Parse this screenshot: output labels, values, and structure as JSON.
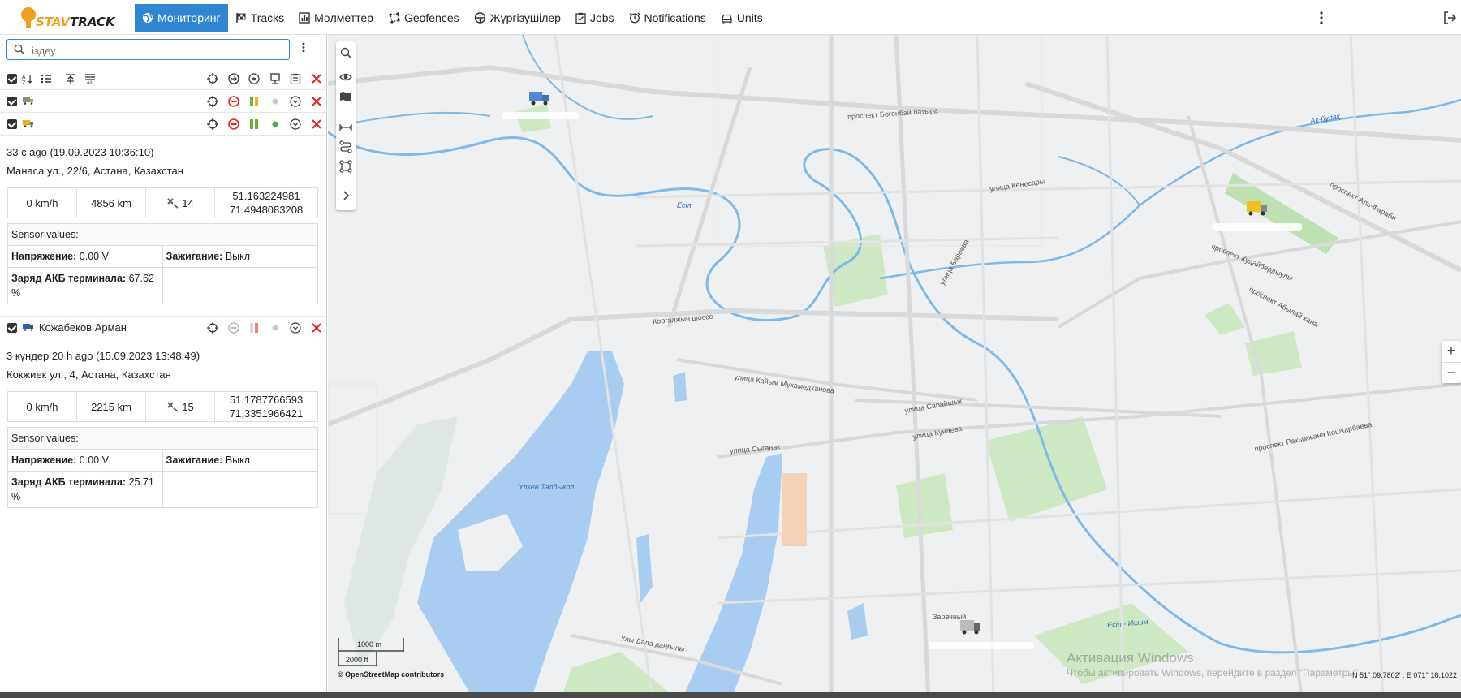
{
  "app": {
    "brand_a": "STAV",
    "brand_b": "TRACK"
  },
  "nav": [
    {
      "label": "Мониторинг",
      "icon": "globe-icon",
      "active": true
    },
    {
      "label": "Tracks",
      "icon": "flag-icon"
    },
    {
      "label": "Мәлметтер",
      "icon": "chart-icon"
    },
    {
      "label": "Geofences",
      "icon": "polygon-icon"
    },
    {
      "label": "Жүргізушілер",
      "icon": "driver-icon"
    },
    {
      "label": "Jobs",
      "icon": "clipboard-icon"
    },
    {
      "label": "Notifications",
      "icon": "alarm-icon"
    },
    {
      "label": "Units",
      "icon": "car-icon"
    }
  ],
  "search": {
    "placeholder": "іздеу"
  },
  "units": [
    {
      "name": ""
    },
    {
      "name": "",
      "last_seen": "33 с ago (19.09.2023 10:36:10)",
      "address": "Манаса ул., 22/6, Астана, Казахстан",
      "speed": "0 km/h",
      "mileage": "4856 km",
      "satellites": "14",
      "lat": "51.163224981",
      "lon": "71.4948083208",
      "sensor_title": "Sensor values:",
      "voltage_label": "Напряжение:",
      "voltage": "0.00 V",
      "ignition_label": "Зажигание:",
      "ignition": "Выкл",
      "battery_label": "Заряд АКБ терминала:",
      "battery": "67.62 %"
    },
    {
      "name": "Кожабеков Арман",
      "last_seen": "3 күндер 20 h ago (15.09.2023 13:48:49)",
      "address": "Кокжиек ул., 4, Астана, Казахстан",
      "speed": "0 km/h",
      "mileage": "2215 km",
      "satellites": "15",
      "lat": "51.1787766593",
      "lon": "71.3351966421",
      "sensor_title": "Sensor values:",
      "voltage_label": "Напряжение:",
      "voltage": "0.00 V",
      "ignition_label": "Зажигание:",
      "ignition": "Выкл",
      "battery_label": "Заряд АКБ терминала:",
      "battery": "25.71 %"
    }
  ],
  "map": {
    "scale_m": "1000 m",
    "scale_ft": "2000 ft",
    "attribution": "© OpenStreetMap contributors",
    "coords": "N 51° 09.7802′ : E 071° 18.1022",
    "watermark_title": "Активация Windows",
    "watermark_sub": "Чтобы активировать Windows, перейдите в раздел \"Параметры\".",
    "labels": {
      "l1": "проспект Богенбай батыра",
      "l2": "проспект Абылай хана",
      "l3": "Коргалжын шоссе",
      "l4": "улица Сарайшык",
      "l5": "улица Кунаева",
      "l6": "проспект Аль-Фараби",
      "l7": "улица Кенесары",
      "l8": "Есіл",
      "l9": "Улкен Талдыкол",
      "l10": "Ақ-бұлақ",
      "l11": "улица Сыганак",
      "l12": "проспект Рахымжана Кошкарбаева",
      "l13": "Улы Дала даңғылы",
      "l14": "Заречный",
      "l15": "Есіл - Ишим",
      "l16": "улица Кайым Мухамедханова",
      "l17": "проспект Кудайбердыулы",
      "l18": "улица Бараева"
    }
  }
}
